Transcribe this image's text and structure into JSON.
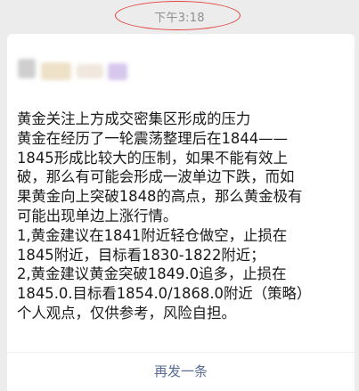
{
  "status": {
    "time": "下午3:18"
  },
  "message": {
    "lines": [
      "黄金关注上方成交密集区形成的压力",
      "黄金在经历了一轮震荡整理后在1844——",
      "1845形成比较大的压制，如果不能有效上",
      "破，那么有可能会形成一波单边下跌，而如",
      "果黄金向上突破1848的高点，那么黄金极有",
      "可能出现单边上涨行情。",
      "1,黄金建议在1841附近轻仓做空，止损在",
      "1845附近，目标看1830-1822附近；",
      "2,黄金建议黄金突破1849.0追多，止损在",
      "1845.0.目标看1854.0/1868.0附近（策略）",
      "个人观点，仅供参考，风险自担。"
    ]
  },
  "actions": {
    "resend_label": "再发一条"
  },
  "colors": {
    "annotation_circle": "#e0433b",
    "link": "#576b95",
    "background": "#ececec"
  }
}
